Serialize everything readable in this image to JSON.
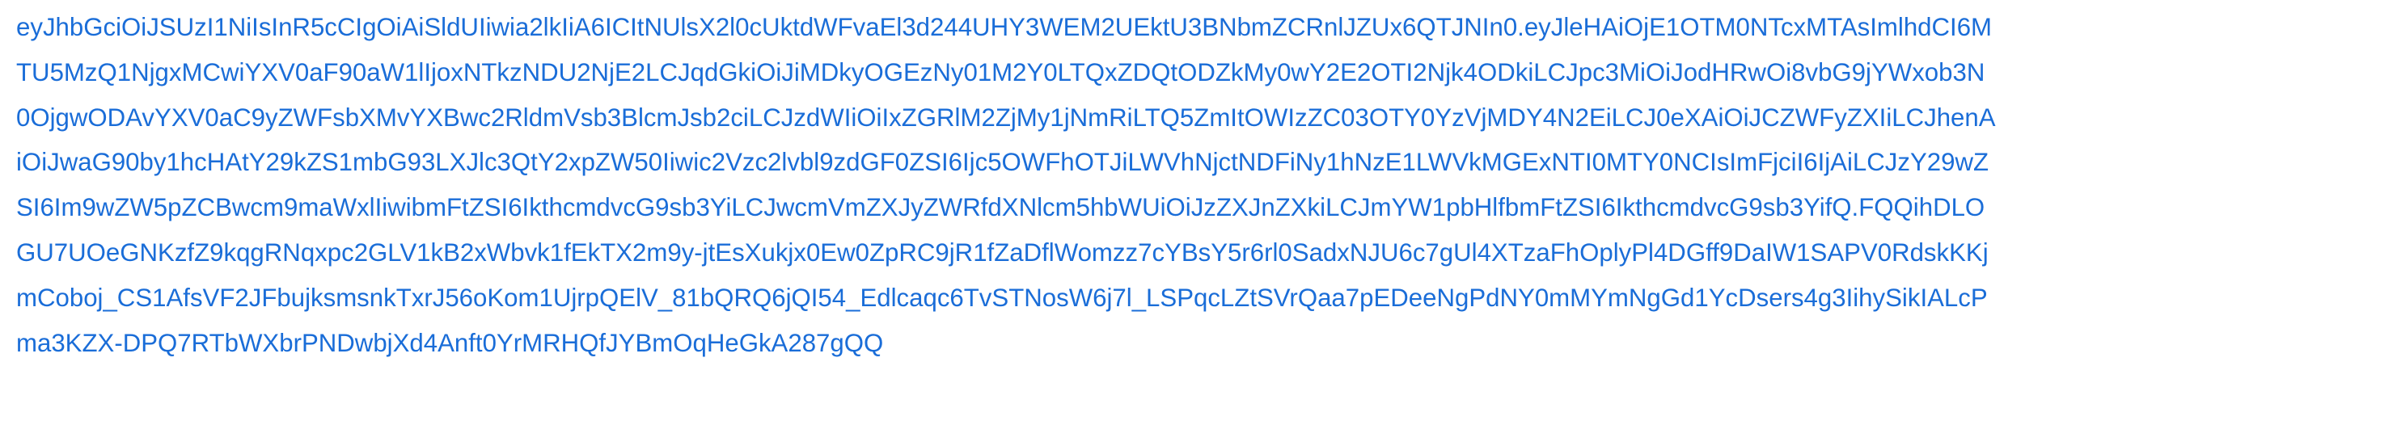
{
  "colors": {
    "background": "#ffffff",
    "text": "#1a6dd8"
  },
  "token": {
    "lines": [
      "eyJhbGciOiJSUzI1NiIsInR5cCIgOiAiSldUIiwia2lkIiA6ICItNUlsX2l0cUktdWFvaEl3d244UHY3WEM2UEktU3BNbmZCRnlJZUx6QTJNIn0.eyJleHAiOjE1OTM0NTcxMTAsImlhdCI6M",
      "TU5MzQ1NjgxMCwiYXV0aF90aW1lIjoxNTkzNDU2NjE2LCJqdGkiOiJiMDkyOGEzNy01M2Y0LTQxZDQtODZkMy0wY2E2OTI2Njk4ODkiLCJpc3MiOiJodHRwOi8vbG9jYWxob3N",
      "0OjgwODAvYXV0aC9yZWFsbXMvYXBwc2RldmVsb3BlcmJsb2ciLCJzdWIiOiIxZGRlM2ZjMy1jNmRiLTQ5ZmItOWIzZC03OTY0YzVjMDY4N2EiLCJ0eXAiOiJCZWFyZXIiLCJhenA",
      "iOiJwaG90by1hcHAtY29kZS1mbG93LXJlc3QtY2xpZW50Iiwic2Vzc2lvbl9zdGF0ZSI6Ijc5OWFhOTJiLWVhNjctNDFiNy1hNzE1LWVkMGExNTI0MTY0NCIsImFjciI6IjAiLCJzY29wZ",
      "SI6Im9wZW5pZCBwcm9maWxlIiwibmFtZSI6IkthcmdvcG9sb3YiLCJwcmVmZXJyZWRfdXNlcm5hbWUiOiJzZXJnZXkiLCJmYW1pbHlfbmFtZSI6IkthcmdvcG9sb3YifQ.FQQihDLO",
      "GU7UOeGNKzfZ9kqgRNqxpc2GLV1kB2xWbvk1fEkTX2m9y-jtEsXukjx0Ew0ZpRC9jR1fZaDflWomzz7cYBsY5r6rl0SadxNJU6c7gUl4XTzaFhOplyPl4DGff9DaIW1SAPV0RdskKKj",
      "mCoboj_CS1AfsVF2JFbujksmsnkTxrJ56oKom1UjrpQElV_81bQRQ6jQI54_Edlcaqc6TvSTNosW6j7l_LSPqcLZtSVrQaa7pEDeeNgPdNY0mMYmNgGd1YcDsers4g3IihySikIALcP",
      "ma3KZX-DPQ7RTbWXbrPNDwbjXd4Anft0YrMRHQfJYBmOqHeGkA287gQQ"
    ]
  }
}
